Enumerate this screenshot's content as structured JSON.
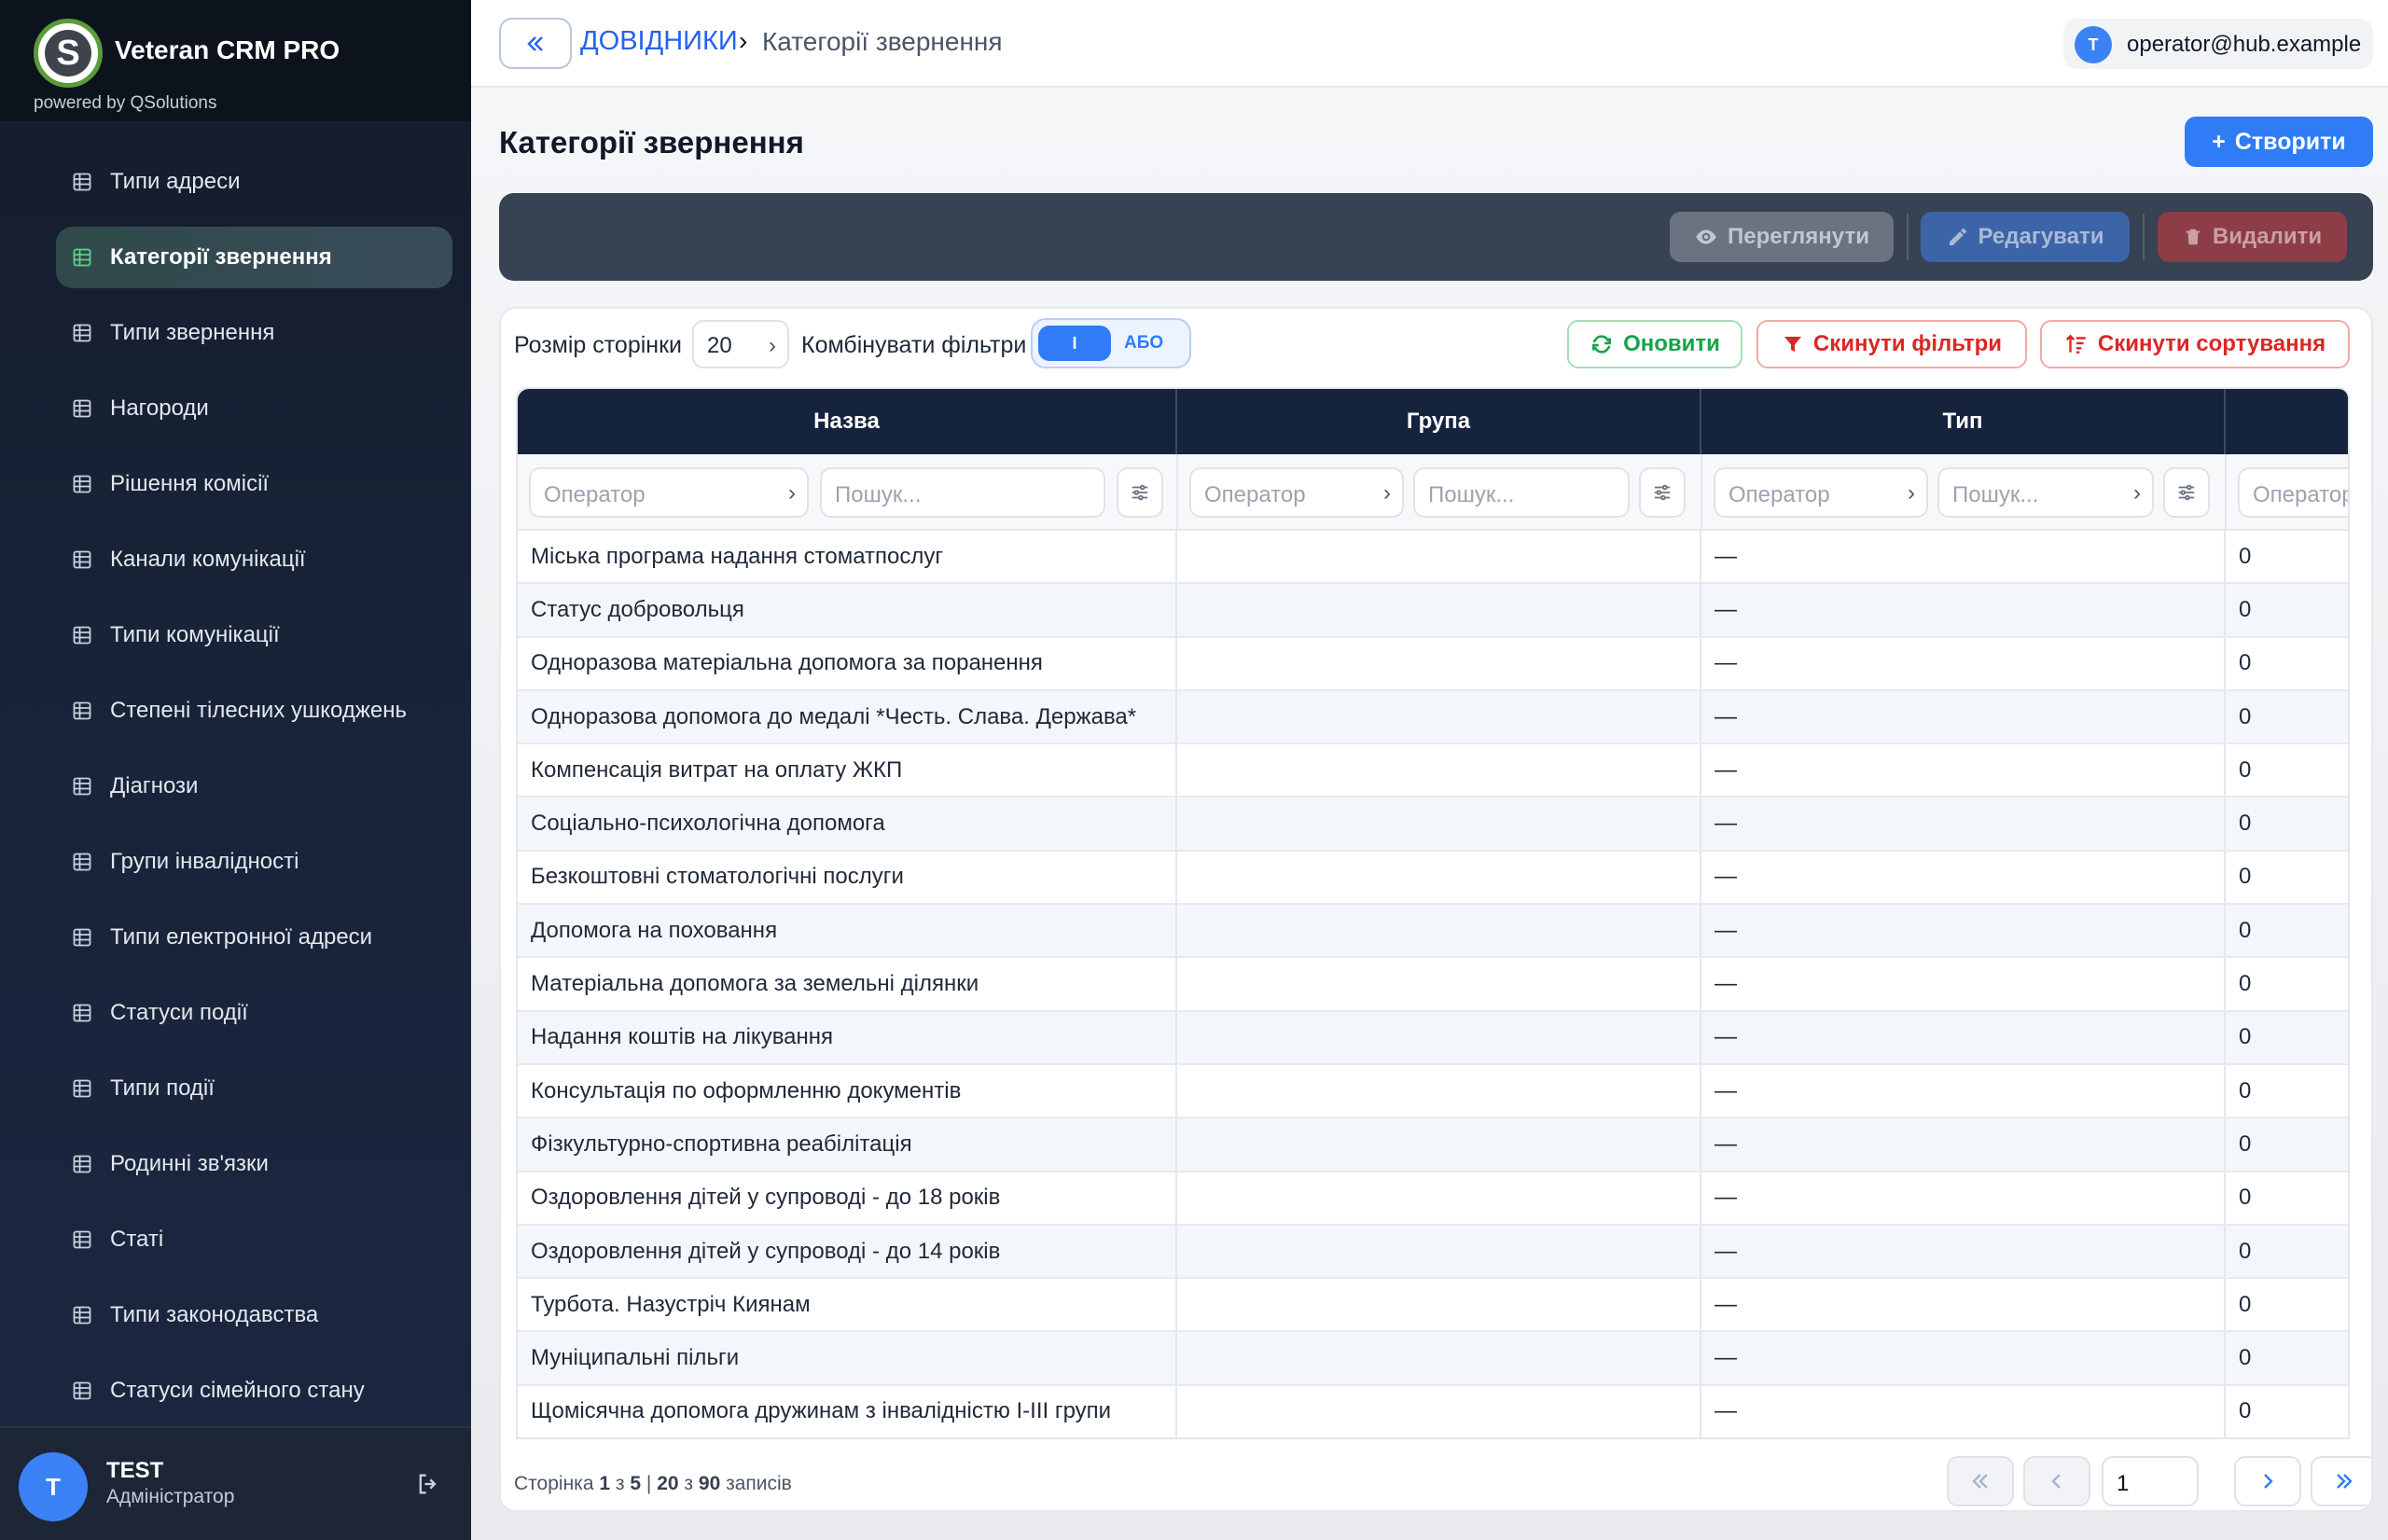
{
  "brand": {
    "logo_letter": "S",
    "title": "Veteran CRM PRO",
    "subtitle": "powered by QSolutions"
  },
  "sidebar": {
    "items": [
      {
        "label": "Типи адреси",
        "active": false
      },
      {
        "label": "Категорії звернення",
        "active": true
      },
      {
        "label": "Типи звернення",
        "active": false
      },
      {
        "label": "Нагороди",
        "active": false
      },
      {
        "label": "Рішення комісії",
        "active": false
      },
      {
        "label": "Канали комунікації",
        "active": false
      },
      {
        "label": "Типи комунікації",
        "active": false
      },
      {
        "label": "Степені тілесних ушкоджень",
        "active": false
      },
      {
        "label": "Діагнози",
        "active": false
      },
      {
        "label": "Групи інвалідності",
        "active": false
      },
      {
        "label": "Типи електронної адреси",
        "active": false
      },
      {
        "label": "Статуси події",
        "active": false
      },
      {
        "label": "Типи події",
        "active": false
      },
      {
        "label": "Родинні зв'язки",
        "active": false
      },
      {
        "label": "Статі",
        "active": false
      },
      {
        "label": "Типи законодавства",
        "active": false
      },
      {
        "label": "Статуси сімейного стану",
        "active": false
      }
    ],
    "user": {
      "initial": "T",
      "name": "TEST",
      "role": "Адміністратор"
    }
  },
  "topbar": {
    "breadcrumb_root": "ДОВІДНИКИ",
    "breadcrumb_sep": "›",
    "breadcrumb_current": "Категорії звернення",
    "user_initial": "T",
    "user_email": "operator@hub.example"
  },
  "page": {
    "title": "Категорії звернення",
    "create_label": "Створити"
  },
  "actions": {
    "view": "Переглянути",
    "edit": "Редагувати",
    "delete": "Видалити"
  },
  "toolbar": {
    "page_size_label": "Розмір сторінки",
    "page_size_value": "20",
    "combine_label": "Комбінувати фільтри",
    "combine_and": "І",
    "combine_or": "АБО",
    "refresh": "Оновити",
    "reset_filters": "Скинути фільтри",
    "reset_sort": "Скинути сортування"
  },
  "table": {
    "columns": [
      "Назва",
      "Група",
      "Тип",
      ""
    ],
    "filter": {
      "operator_placeholder": "Оператор",
      "search_placeholder": "Пошук..."
    },
    "rows": [
      [
        "Міська програма надання стоматпослуг",
        "",
        "—",
        "0"
      ],
      [
        "Статус добровольця",
        "",
        "—",
        "0"
      ],
      [
        "Одноразова матеріальна допомога за поранення",
        "",
        "—",
        "0"
      ],
      [
        "Одноразова допомога до медалі *Честь. Слава. Держава*",
        "",
        "—",
        "0"
      ],
      [
        "Компенсація витрат на оплату ЖКП",
        "",
        "—",
        "0"
      ],
      [
        "Соціально-психологічна допомога",
        "",
        "—",
        "0"
      ],
      [
        "Безкоштовні стоматологічні послуги",
        "",
        "—",
        "0"
      ],
      [
        "Допомога на поховання",
        "",
        "—",
        "0"
      ],
      [
        "Матеріальна допомога за земельні ділянки",
        "",
        "—",
        "0"
      ],
      [
        "Надання коштів на лікування",
        "",
        "—",
        "0"
      ],
      [
        "Консультація по оформленню документів",
        "",
        "—",
        "0"
      ],
      [
        "Фізкультурно-спортивна реабілітація",
        "",
        "—",
        "0"
      ],
      [
        "Оздоровлення дітей у супроводі - до 18 років",
        "",
        "—",
        "0"
      ],
      [
        "Оздоровлення дітей у супроводі - до 14 років",
        "",
        "—",
        "0"
      ],
      [
        "Турбота. Назустріч Киянам",
        "",
        "—",
        "0"
      ],
      [
        "Муніципальні пільги",
        "",
        "—",
        "0"
      ],
      [
        "Щомісячна допомога дружинам з інвалідністю I-III групи",
        "",
        "—",
        "0"
      ]
    ]
  },
  "footer": {
    "page_word": "Сторінка",
    "page_current": "1",
    "of_word": "з",
    "page_total": "5",
    "sep": "|",
    "shown": "20",
    "records_total": "90",
    "records_word": "записів",
    "page_input_value": "1"
  },
  "colors": {
    "accent": "#2f7cf6",
    "sidebar_bg": "#182338",
    "header_bg": "#15233d",
    "success": "#16a34a",
    "danger": "#dc2626"
  }
}
